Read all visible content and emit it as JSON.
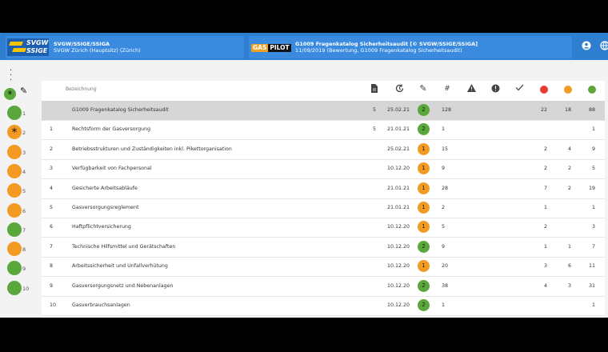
{
  "header": {
    "org_title": "SVGW/SSIGE/SSIGA",
    "org_subtitle": "SVGW Zürich (Hauptsitz) (Zürich)",
    "logo_line1": "SVGW",
    "logo_line2": "SSIGE",
    "app_logo_gas": "GAS",
    "app_logo_pilot": "PILOT",
    "doc_title": "G1009 Fragenkatalog Sicherheitsaudit [© SVGW/SSIGE/SSIGA]",
    "doc_subtitle": "11/09/2019 (Bewertung, G1009 Fragenkatalog Sicherheitsaudit)"
  },
  "table": {
    "col_name": "Bezeichnung",
    "header_icons": [
      "document-icon",
      "history-icon",
      "edit-icon",
      "hash-icon",
      "warning-icon",
      "alert-icon",
      "check-icon"
    ],
    "hash_label": "#",
    "rows": [
      {
        "num": "",
        "name": "G1009 Fragenkatalog Sicherheitsaudit",
        "docs": "5",
        "date": "25.02.21",
        "status": "2",
        "status_color": "green",
        "count": "128",
        "red": "22",
        "orange": "18",
        "green": "88"
      },
      {
        "num": "1",
        "name": "Rechtsform der Gasversorgung",
        "docs": "5",
        "date": "21.01.21",
        "status": "2",
        "status_color": "green",
        "count": "1",
        "red": "",
        "orange": "",
        "green": "1"
      },
      {
        "num": "2",
        "name": "Betriebsstrukturen und Zuständigkeiten inkl. Pikettorganisation",
        "docs": "",
        "date": "25.02.21",
        "status": "1",
        "status_color": "orange",
        "count": "15",
        "red": "2",
        "orange": "4",
        "green": "9"
      },
      {
        "num": "3",
        "name": "Verfügbarkeit von Fachpersonal",
        "docs": "",
        "date": "10.12.20",
        "status": "1",
        "status_color": "orange",
        "count": "9",
        "red": "2",
        "orange": "2",
        "green": "5"
      },
      {
        "num": "4",
        "name": "Gesicherte Arbeitsabläufe",
        "docs": "",
        "date": "21.01.21",
        "status": "1",
        "status_color": "orange",
        "count": "28",
        "red": "7",
        "orange": "2",
        "green": "19"
      },
      {
        "num": "5",
        "name": "Gasversorgungsreglement",
        "docs": "",
        "date": "21.01.21",
        "status": "1",
        "status_color": "orange",
        "count": "2",
        "red": "1",
        "orange": "",
        "green": "1"
      },
      {
        "num": "6",
        "name": "Haftpflichtversicherung",
        "docs": "",
        "date": "10.12.20",
        "status": "1",
        "status_color": "orange",
        "count": "5",
        "red": "2",
        "orange": "",
        "green": "3"
      },
      {
        "num": "7",
        "name": "Technische Hilfsmittel und Gerätschaften",
        "docs": "",
        "date": "10.12.20",
        "status": "2",
        "status_color": "green",
        "count": "9",
        "red": "1",
        "orange": "1",
        "green": "7"
      },
      {
        "num": "8",
        "name": "Arbeitssicherheit und Unfallverhütung",
        "docs": "",
        "date": "10.12.20",
        "status": "1",
        "status_color": "orange",
        "count": "20",
        "red": "3",
        "orange": "6",
        "green": "11"
      },
      {
        "num": "9",
        "name": "Gasversorgungsnetz und Nebenanlagen",
        "docs": "",
        "date": "10.12.20",
        "status": "2",
        "status_color": "green",
        "count": "38",
        "red": "4",
        "orange": "3",
        "green": "31"
      },
      {
        "num": "10",
        "name": "Gasverbrauchsanlagen",
        "docs": "",
        "date": "10.12.20",
        "status": "2",
        "status_color": "green",
        "count": "1",
        "red": "",
        "orange": "",
        "green": "1"
      }
    ]
  },
  "sidebar": {
    "items": [
      {
        "label": "1",
        "color": "green",
        "star": false
      },
      {
        "label": "2",
        "color": "orange",
        "star": true
      },
      {
        "label": "3",
        "color": "orange",
        "star": false
      },
      {
        "label": "4",
        "color": "orange",
        "star": false
      },
      {
        "label": "5",
        "color": "orange",
        "star": false
      },
      {
        "label": "6",
        "color": "orange",
        "star": false
      },
      {
        "label": "7",
        "color": "green",
        "star": false
      },
      {
        "label": "8",
        "color": "orange",
        "star": false
      },
      {
        "label": "9",
        "color": "green",
        "star": false
      },
      {
        "label": "10",
        "color": "green",
        "star": false
      }
    ]
  },
  "colors": {
    "topbar": "#2f7fd0",
    "green": "#5aa83c",
    "orange": "#f39a22",
    "red": "#e63c2e"
  }
}
